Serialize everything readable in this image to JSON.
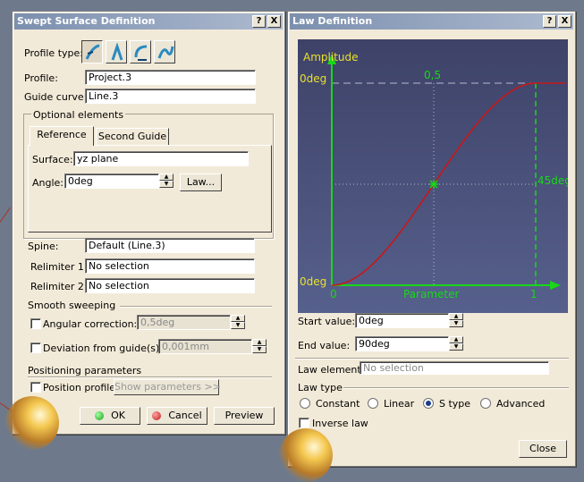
{
  "swept": {
    "title": "Swept Surface Definition",
    "help": "?",
    "close": "X",
    "profile_type_label": "Profile type:",
    "profile_label": "Profile:",
    "profile_value": "Project.3",
    "guide_label": "Guide curve:",
    "guide_value": "Line.3",
    "optional_label": "Optional elements",
    "tabs": [
      "Reference",
      "Second Guide"
    ],
    "surface_label": "Surface:",
    "surface_value": "yz plane",
    "angle_label": "Angle:",
    "angle_value": "0deg",
    "law_button": "Law...",
    "spine_label": "Spine:",
    "spine_value": "Default (Line.3)",
    "relimiter1_label": "Relimiter 1:",
    "relimiter1_value": "No selection",
    "relimiter2_label": "Relimiter 2:",
    "relimiter2_value": "No selection",
    "smooth_label": "Smooth sweeping",
    "angular_label": "Angular correction:",
    "angular_value": "0,5deg",
    "deviation_label": "Deviation from guide(s):",
    "deviation_value": "0,001mm",
    "positioning_label": "Positioning parameters",
    "position_profile_label": "Position profile",
    "show_params_button": "Show parameters >>",
    "ok": "OK",
    "cancel": "Cancel",
    "preview": "Preview"
  },
  "law": {
    "title": "Law Definition",
    "help": "?",
    "close": "X",
    "graph": {
      "amplitude": "Amplitude",
      "top_left": "0deg",
      "bottom_left": "0deg",
      "mid_top": "0,5",
      "mid_right": "45deg",
      "x_start": "0",
      "x_end": "1",
      "x_label": "Parameter"
    },
    "start_label": "Start value:",
    "start_value": "0deg",
    "end_label": "End value:",
    "end_value": "90deg",
    "element_label": "Law element:",
    "element_placeholder": "No selection",
    "law_type_label": "Law type",
    "types": [
      "Constant",
      "Linear",
      "S type",
      "Advanced"
    ],
    "selected_type": "S type",
    "inverse_label": "Inverse law",
    "close_button": "Close"
  },
  "colors": {
    "title_bar": "#7b8fae",
    "graph_bg": "#4a4f78",
    "axis": "#18d818",
    "curve": "#c81818",
    "label_yellow": "#e8e030"
  }
}
